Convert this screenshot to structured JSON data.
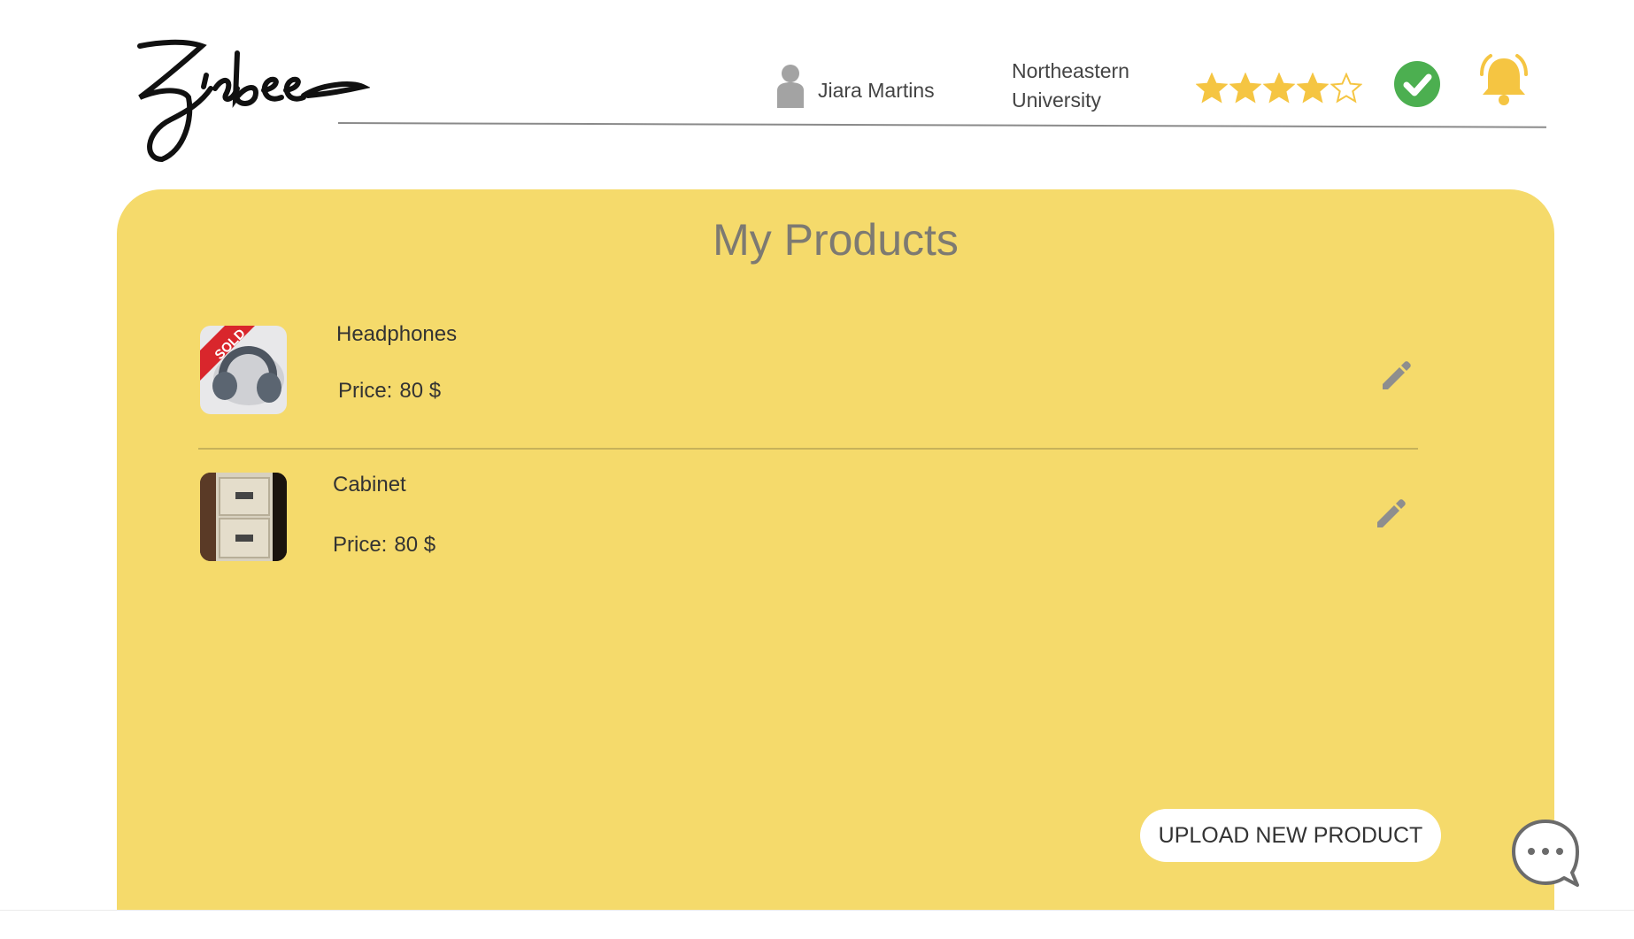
{
  "brand": {
    "logo_text": "Zigbee",
    "accent_color": "#f5da6b"
  },
  "header": {
    "user_name": "Jiara Martins",
    "university": "Northeastern University",
    "rating": {
      "value": 4,
      "max": 5
    },
    "verified_color": "#4caf50",
    "bell_color": "#f5c542",
    "icons": [
      "user-icon",
      "star-icon",
      "verified-check-icon",
      "bell-icon"
    ]
  },
  "main": {
    "title": "My Products",
    "products": [
      {
        "name": "Headphones",
        "price_label": "Price:",
        "price_value": "80 $",
        "badge": "SOLD",
        "image": "headphones-photo"
      },
      {
        "name": "Cabinet",
        "price_label": "Price:",
        "price_value": "80 $",
        "image": "cabinet-photo"
      }
    ],
    "upload_label": "UPLOAD NEW PRODUCT"
  },
  "chat": {
    "icon": "chat-bubble-icon"
  }
}
